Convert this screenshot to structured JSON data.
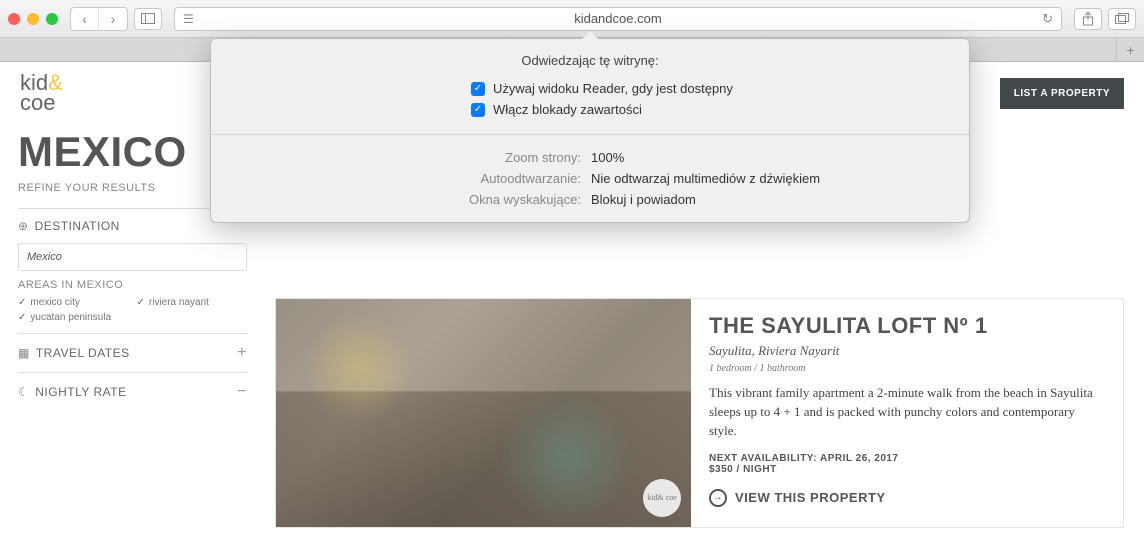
{
  "browser": {
    "url": "kidandcoe.com"
  },
  "popover": {
    "title": "Odwiedzając tę witrynę:",
    "reader_label": "Używaj widoku Reader, gdy jest dostępny",
    "content_blockers_label": "Włącz blokady zawartości",
    "zoom_label": "Zoom strony:",
    "zoom_value": "100%",
    "autoplay_label": "Autoodtwarzanie:",
    "autoplay_value": "Nie odtwarzaj multimediów z dźwiękiem",
    "popups_label": "Okna wyskakujące:",
    "popups_value": "Blokuj i powiadom"
  },
  "site": {
    "logo_line1": "kid",
    "logo_amp": "&",
    "logo_line2": "coe",
    "cta": "LIST A PROPERTY",
    "page_title": "MEXICO",
    "refine": "REFINE YOUR RESULTS",
    "filters": {
      "destination_label": "DESTINATION",
      "destination_value": "Mexico",
      "areas_label": "AREAS IN MEXICO",
      "areas": [
        "mexico city",
        "riviera nayarit",
        "yucatan peninsula"
      ],
      "travel_dates_label": "TRAVEL DATES",
      "nightly_rate_label": "NIGHTLY RATE"
    },
    "listing": {
      "title": "THE SAYULITA LOFT Nº 1",
      "location": "Sayulita, Riviera Nayarit",
      "rooms": "1 bedroom / 1 bathroom",
      "description": "This vibrant family apartment a 2-minute walk from the beach in Sayulita sleeps up to 4 + 1 and is packed with punchy colors and contemporary style.",
      "availability": "NEXT AVAILABILITY: APRIL 26, 2017",
      "price": "$350 / NIGHT",
      "view_label": "VIEW THIS PROPERTY",
      "badge": "kid& coe"
    }
  }
}
